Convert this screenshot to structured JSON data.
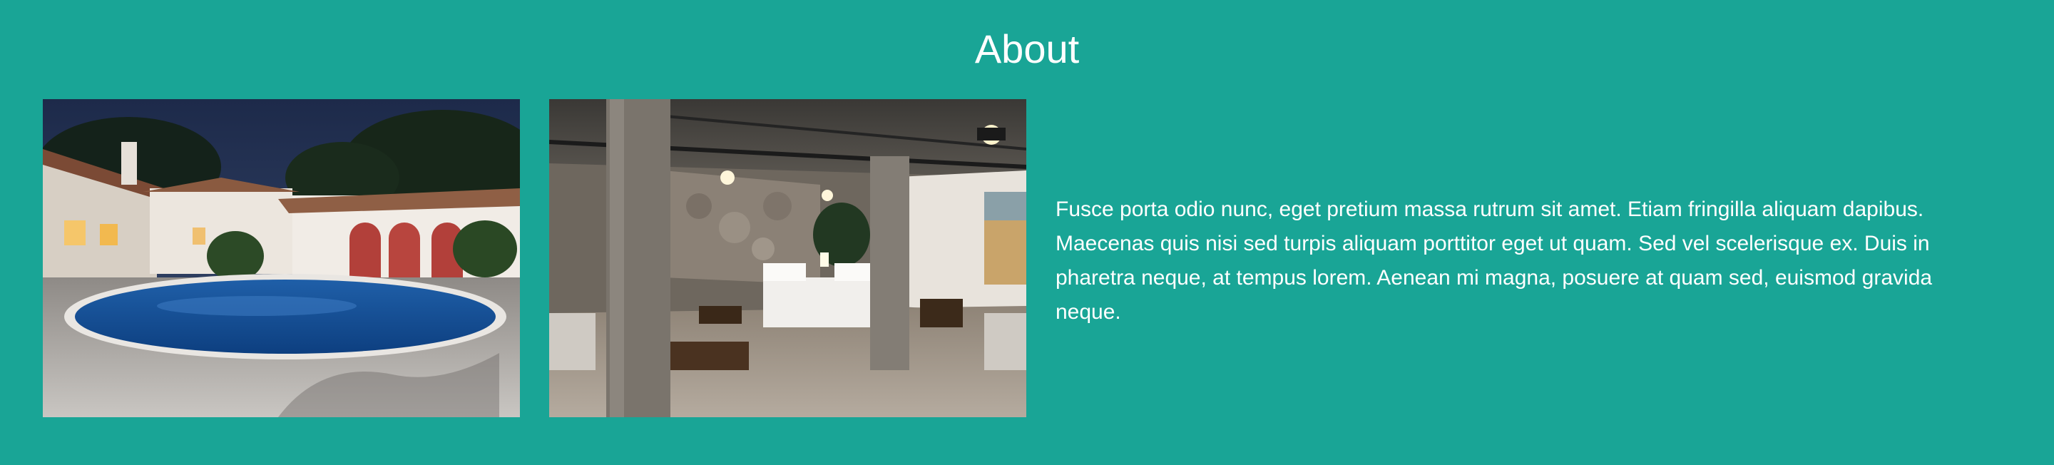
{
  "about": {
    "title": "About",
    "body": "Fusce porta odio nunc, eget pretium massa rutrum sit amet. Etiam fringilla aliquam dapibus. Maecenas quis nisi sed turpis aliquam porttitor eget ut quam. Sed vel scelerisque ex. Duis in pharetra neque, at tempus lorem. Aenean mi magna, posuere at quam sed, euismod gravida neque."
  },
  "images": [
    {
      "name": "villa-pool-photo"
    },
    {
      "name": "loft-bedroom-photo"
    }
  ],
  "colors": {
    "background": "#19a596",
    "text": "#ffffff"
  }
}
